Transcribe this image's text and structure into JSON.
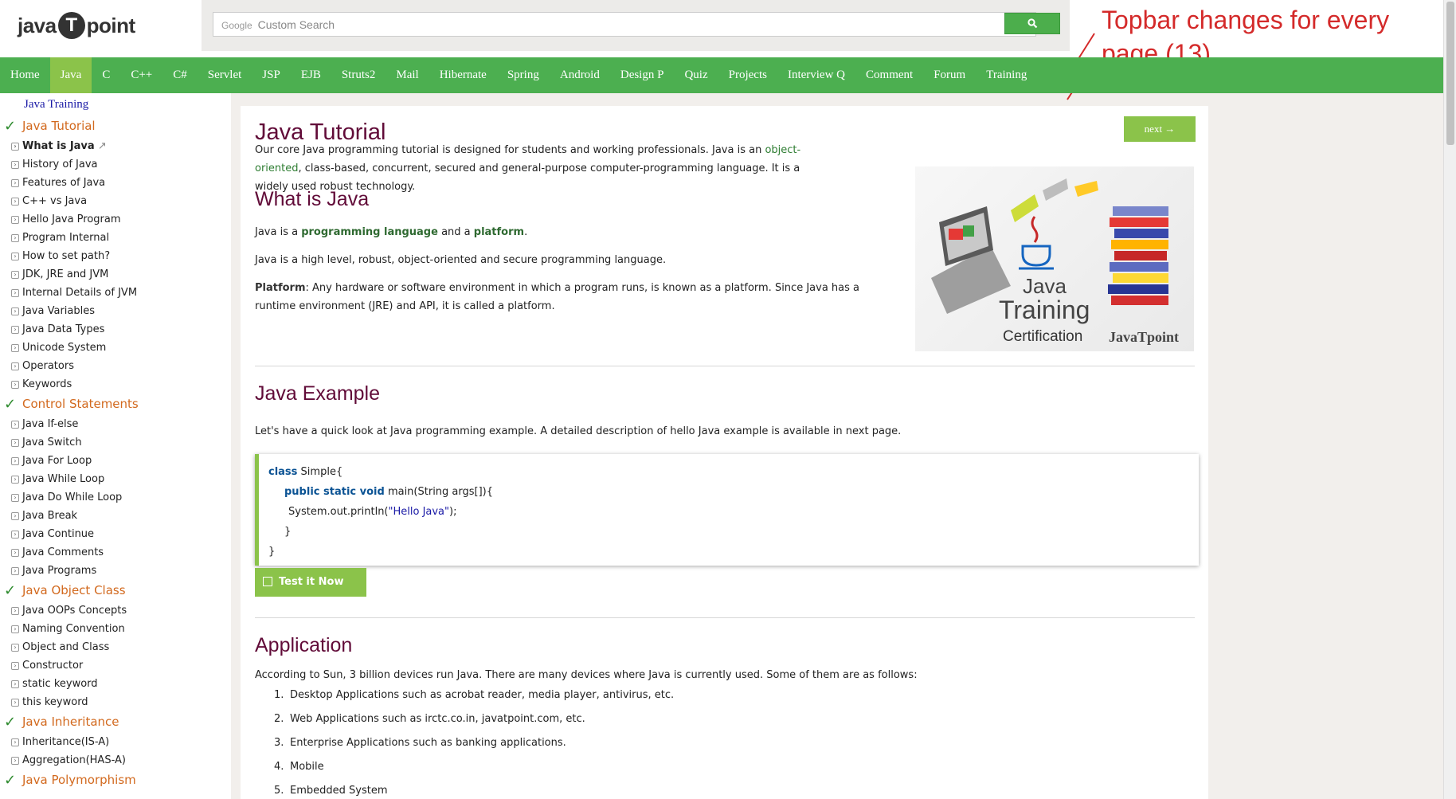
{
  "header": {
    "logo_left": "java",
    "logo_mark": "T",
    "logo_right": "point",
    "search_brand": "Google",
    "search_placeholder": "Custom Search"
  },
  "annotation": {
    "text": "Topbar changes for every page (13)"
  },
  "nav": {
    "items": [
      "Home",
      "Java",
      "C",
      "C++",
      "C#",
      "Servlet",
      "JSP",
      "EJB",
      "Struts2",
      "Mail",
      "Hibernate",
      "Spring",
      "Android",
      "Design P",
      "Quiz",
      "Projects",
      "Interview Q",
      "Comment",
      "Forum",
      "Training"
    ],
    "active": "Java"
  },
  "sidebar": {
    "training_link": "Java Training",
    "sections": [
      {
        "title": "Java Tutorial",
        "items": [
          "What is Java",
          "History of Java",
          "Features of Java",
          "C++ vs Java",
          "Hello Java Program",
          "Program Internal",
          "How to set path?",
          "JDK, JRE and JVM",
          "Internal Details of JVM",
          "Java Variables",
          "Java Data Types",
          "Unicode System",
          "Operators",
          "Keywords"
        ]
      },
      {
        "title": "Control Statements",
        "items": [
          "Java If-else",
          "Java Switch",
          "Java For Loop",
          "Java While Loop",
          "Java Do While Loop",
          "Java Break",
          "Java Continue",
          "Java Comments",
          "Java Programs"
        ]
      },
      {
        "title": "Java Object Class",
        "items": [
          "Java OOPs Concepts",
          "Naming Convention",
          "Object and Class",
          "Constructor",
          "static keyword",
          "this keyword"
        ]
      },
      {
        "title": "Java Inheritance",
        "items": [
          "Inheritance(IS-A)",
          "Aggregation(HAS-A)"
        ]
      },
      {
        "title": "Java Polymorphism",
        "items": []
      }
    ],
    "current_item": "What is Java"
  },
  "main": {
    "next_label": "next →",
    "title": "Java Tutorial",
    "intro_pre": "Our core Java programming tutorial is designed for students and working professionals. Java is an ",
    "intro_link": "object-oriented",
    "intro_post": ", class-based, concurrent, secured and general-purpose computer-programming language. It is a widely used robust technology.",
    "h_what": "What is Java",
    "what_pre": "Java is a ",
    "what_link1": "programming language",
    "what_mid": " and a ",
    "what_link2": "platform",
    "what_end": ".",
    "what_p2": "Java is a high level, robust, object-oriented and secure programming language.",
    "platform_label": "Platform",
    "platform_text": ": Any hardware or software environment in which a program runs, is known as a platform. Since Java has a runtime environment (JRE) and API, it is called a platform.",
    "hero": {
      "line1": "Java",
      "line2": "Training",
      "line3": "Certification",
      "brand": "JavaTpoint"
    },
    "h_example": "Java Example",
    "example_p": "Let's have a quick look at Java programming example. A detailed description of hello Java example is available in next page.",
    "code": {
      "l1_kw": "class",
      "l1_rest": " Simple{",
      "l2_kw": "public static void",
      "l2_rest": " main(String args[]){",
      "l3_pre": "System.out.println(",
      "l3_str": "\"Hello Java\"",
      "l3_post": ");",
      "l4": "}",
      "l5": "}"
    },
    "test_label": "Test it Now",
    "h_application": "Application",
    "app_p": "According to Sun, 3 billion devices run Java. There are many devices where Java is currently used. Some of them are as follows:",
    "app_list": [
      "Desktop Applications such as acrobat reader, media player, antivirus, etc.",
      "Web Applications such as irctc.co.in, javatpoint.com, etc.",
      "Enterprise Applications such as banking applications.",
      "Mobile",
      "Embedded System"
    ]
  }
}
